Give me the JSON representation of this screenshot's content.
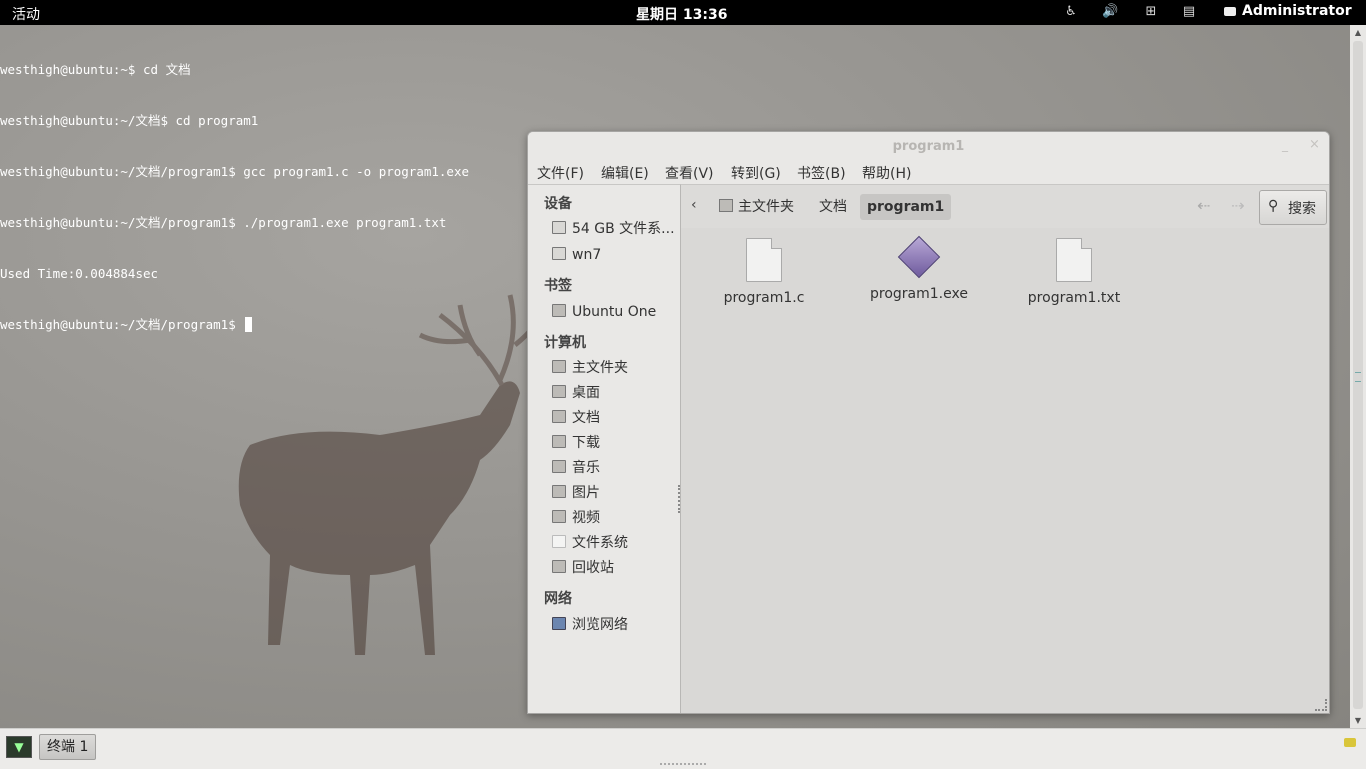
{
  "top_panel": {
    "activities": "活动",
    "clock": "星期日 13:36",
    "user": "Administrator",
    "icons": [
      "accessibility-icon",
      "volume-icon",
      "network-icon",
      "clipboard-icon"
    ]
  },
  "terminal": {
    "lines": [
      "westhigh@ubuntu:~$ cd 文档",
      "westhigh@ubuntu:~/文档$ cd program1",
      "westhigh@ubuntu:~/文档/program1$ gcc program1.c -o program1.exe",
      "westhigh@ubuntu:~/文档/program1$ ./program1.exe program1.txt",
      "Used Time:0.004884sec",
      "westhigh@ubuntu:~/文档/program1$ "
    ]
  },
  "file_manager": {
    "title": "program1",
    "minimize": "_",
    "close": "×",
    "menu": [
      "文件(F)",
      "编辑(E)",
      "查看(V)",
      "转到(G)",
      "书签(B)",
      "帮助(H)"
    ],
    "sidebar": {
      "devices_heading": "设备",
      "devices": [
        "54 GB 文件系...",
        "wn7"
      ],
      "bookmarks_heading": "书签",
      "bookmarks": [
        "Ubuntu One"
      ],
      "computer_heading": "计算机",
      "computer": [
        "主文件夹",
        "桌面",
        "文档",
        "下载",
        "音乐",
        "图片",
        "视频",
        "文件系统",
        "回收站"
      ],
      "network_heading": "网络",
      "network": [
        "浏览网络"
      ]
    },
    "toolbar": {
      "back_glyph": "‹",
      "breadcrumbs": [
        "主文件夹",
        "文档",
        "program1"
      ],
      "search_label": "搜索"
    },
    "files": [
      {
        "name": "program1.c",
        "icon": "text-file-icon"
      },
      {
        "name": "program1.exe",
        "icon": "executable-icon"
      },
      {
        "name": "program1.txt",
        "icon": "text-file-icon"
      }
    ]
  },
  "bottom_panel": {
    "taskbar_item": "终端 1"
  }
}
